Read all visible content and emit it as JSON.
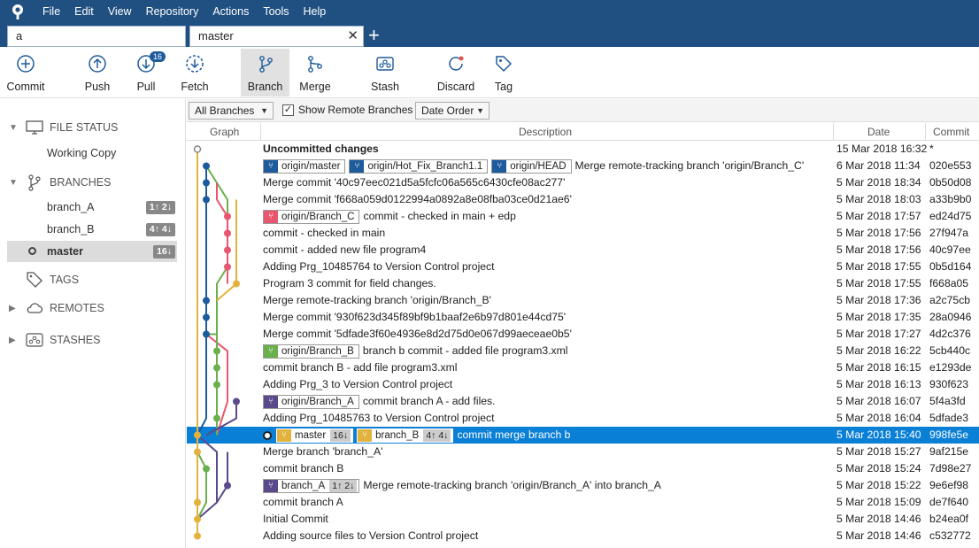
{
  "menu": [
    "File",
    "Edit",
    "View",
    "Repository",
    "Actions",
    "Tools",
    "Help"
  ],
  "tabs": {
    "first": "a",
    "second": "master"
  },
  "toolbar": {
    "commit": "Commit",
    "push": "Push",
    "pull": "Pull",
    "pull_badge": "16",
    "fetch": "Fetch",
    "branch": "Branch",
    "merge": "Merge",
    "stash": "Stash",
    "discard": "Discard",
    "tag": "Tag"
  },
  "sidebar": {
    "file_status": "FILE STATUS",
    "working_copy": "Working Copy",
    "branches": "BRANCHES",
    "branch_items": [
      {
        "name": "branch_A",
        "badge": "1↑ 2↓"
      },
      {
        "name": "branch_B",
        "badge": "4↑ 4↓"
      },
      {
        "name": "master",
        "badge": "16↓"
      }
    ],
    "tags": "TAGS",
    "remotes": "REMOTES",
    "stashes": "STASHES"
  },
  "filter": {
    "branches": "All Branches",
    "show_remote": "Show Remote Branches",
    "order": "Date Order"
  },
  "columns": {
    "graph": "Graph",
    "description": "Description",
    "date": "Date",
    "commit": "Commit"
  },
  "colors": {
    "header": "#205081",
    "selected": "#0a7fd6",
    "label_blue": "#1e5b9c",
    "label_red": "#e8566f",
    "label_green": "#6ab04c",
    "label_purple": "#5b4a8b",
    "label_yellow": "#e3b23c"
  },
  "commits": [
    {
      "labels": [],
      "desc": "Uncommitted changes",
      "date": "15 Mar 2018 16:32",
      "hash": "*"
    },
    {
      "labels": [
        {
          "t": "origin/master",
          "c": "#1e5b9c"
        },
        {
          "t": "origin/Hot_Fix_Branch1.1",
          "c": "#1e5b9c"
        },
        {
          "t": "origin/HEAD",
          "c": "#1e5b9c"
        }
      ],
      "desc": "Merge remote-tracking branch 'origin/Branch_C'",
      "date": "6 Mar 2018 11:34",
      "hash": "020e553"
    },
    {
      "labels": [],
      "desc": "Merge commit '40c97eec021d5a5fcfc06a565c6430cfe08ac277'",
      "date": "5 Mar 2018 18:34",
      "hash": "0b50d08"
    },
    {
      "labels": [],
      "desc": "Merge commit 'f668a059d0122994a0892a8e08fba03ce0d21ae6'",
      "date": "5 Mar 2018 18:03",
      "hash": "a33b9b0"
    },
    {
      "labels": [
        {
          "t": "origin/Branch_C",
          "c": "#e8566f"
        }
      ],
      "desc": "commit - checked in main + edp",
      "date": "5 Mar 2018 17:57",
      "hash": "ed24d75"
    },
    {
      "labels": [],
      "desc": "commit - checked in main",
      "date": "5 Mar 2018 17:56",
      "hash": "27f947a"
    },
    {
      "labels": [],
      "desc": "commit - added new file program4",
      "date": "5 Mar 2018 17:56",
      "hash": "40c97ee"
    },
    {
      "labels": [],
      "desc": "Adding Prg_10485764 to Version Control project",
      "date": "5 Mar 2018 17:55",
      "hash": "0b5d164"
    },
    {
      "labels": [],
      "desc": "Program 3 commit for field changes.",
      "date": "5 Mar 2018 17:55",
      "hash": "f668a05"
    },
    {
      "labels": [],
      "desc": "Merge remote-tracking branch 'origin/Branch_B'",
      "date": "5 Mar 2018 17:36",
      "hash": "a2c75cb"
    },
    {
      "labels": [],
      "desc": "Merge commit '930f623d345f89bf9b1baaf2e6b97d801e44cd75'",
      "date": "5 Mar 2018 17:35",
      "hash": "28a0946"
    },
    {
      "labels": [],
      "desc": "Merge commit '5dfade3f60e4936e8d2d75d0e067d99aeceae0b5'",
      "date": "5 Mar 2018 17:27",
      "hash": "4d2c376"
    },
    {
      "labels": [
        {
          "t": "origin/Branch_B",
          "c": "#6ab04c"
        }
      ],
      "desc": "branch b commit - added file program3.xml",
      "date": "5 Mar 2018 16:22",
      "hash": "5cb440c"
    },
    {
      "labels": [],
      "desc": "commit branch B - add file program3.xml",
      "date": "5 Mar 2018 16:15",
      "hash": "e1293de"
    },
    {
      "labels": [],
      "desc": "Adding Prg_3 to Version Control project",
      "date": "5 Mar 2018 16:13",
      "hash": "930f623"
    },
    {
      "labels": [
        {
          "t": "origin/Branch_A",
          "c": "#5b4a8b"
        }
      ],
      "desc": "commit branch A - add files.",
      "date": "5 Mar 2018 16:07",
      "hash": "5f4a3fd"
    },
    {
      "labels": [],
      "desc": "Adding Prg_10485763 to Version Control project",
      "date": "5 Mar 2018 16:04",
      "hash": "5dfade3"
    },
    {
      "labels": [
        {
          "t": "master",
          "c": "#e3b23c",
          "b": "16↓"
        },
        {
          "t": "branch_B",
          "c": "#e3b23c",
          "b": "4↑ 4↓"
        }
      ],
      "desc": "commit merge branch b",
      "date": "5 Mar 2018 15:40",
      "hash": "998fe5e"
    },
    {
      "labels": [],
      "desc": "Merge branch 'branch_A'",
      "date": "5 Mar 2018 15:27",
      "hash": "9af215e"
    },
    {
      "labels": [],
      "desc": "commit branch B",
      "date": "5 Mar 2018 15:24",
      "hash": "7d98e27"
    },
    {
      "labels": [
        {
          "t": "branch_A",
          "c": "#5b4a8b",
          "b": "1↑ 2↓"
        }
      ],
      "desc": "Merge remote-tracking branch 'origin/Branch_A' into branch_A",
      "date": "5 Mar 2018 15:22",
      "hash": "9e6ef98"
    },
    {
      "labels": [],
      "desc": "commit branch A",
      "date": "5 Mar 2018 15:09",
      "hash": "de7f640"
    },
    {
      "labels": [],
      "desc": "Initial Commit",
      "date": "5 Mar 2018 14:46",
      "hash": "b24ea0f"
    },
    {
      "labels": [],
      "desc": "Adding source files to Version Control project",
      "date": "5 Mar 2018 14:46",
      "hash": "c532772"
    }
  ],
  "selected_index": 17
}
